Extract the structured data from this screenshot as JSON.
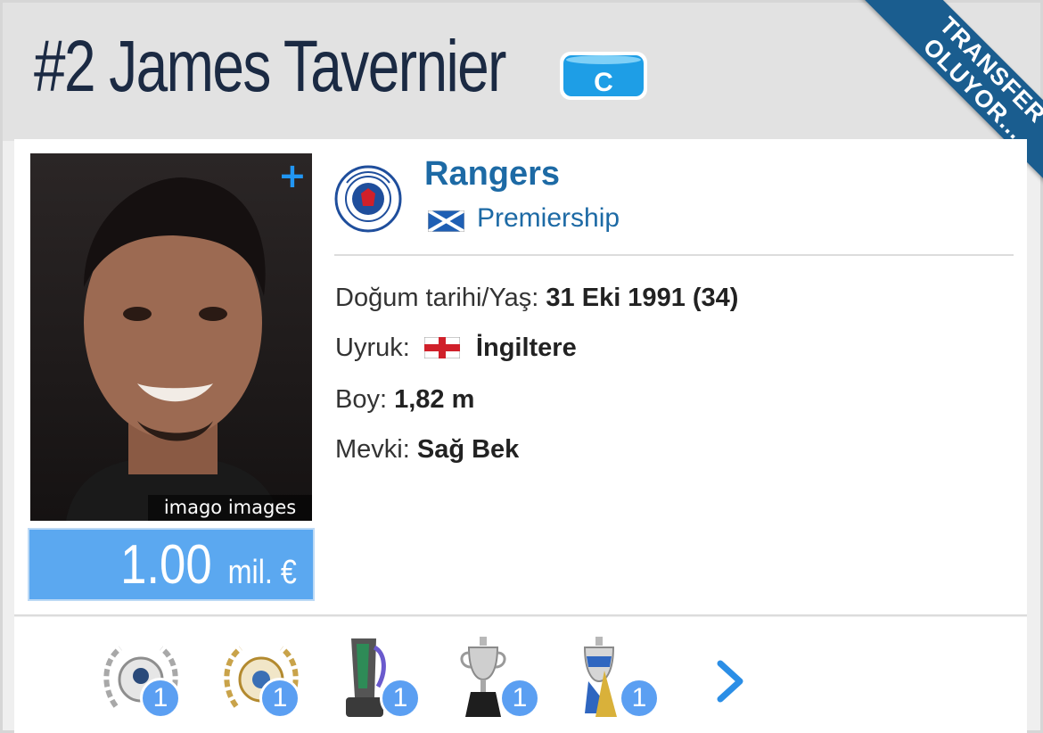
{
  "header": {
    "title": "#2 James Tavernier",
    "captain_badge": "C",
    "ribbon_line1": "TRANSFER",
    "ribbon_line2": "OLUYOR..."
  },
  "player": {
    "photo_credit": "imago images",
    "market_value_number": "1.00",
    "market_value_unit": "mil. €"
  },
  "club": {
    "name": "Rangers",
    "league": "Premiership",
    "league_flag": "scotland-flag"
  },
  "details": {
    "birth_label": "Doğum tarihi/Yaş:",
    "birth_value": "31 Eki 1991 (34)",
    "nationality_label": "Uyruk:",
    "nationality_value": "İngiltere",
    "height_label": "Boy:",
    "height_value": "1,82 m",
    "position_label": "Mevki:",
    "position_value": "Sağ Bek"
  },
  "trophies": [
    {
      "icon": "laurel-medal-icon",
      "count": "1"
    },
    {
      "icon": "gold-laurel-medal-icon",
      "count": "1"
    },
    {
      "icon": "league-trophy-icon",
      "count": "1"
    },
    {
      "icon": "silver-cup-icon",
      "count": "1"
    },
    {
      "icon": "league-cup-icon",
      "count": "1"
    }
  ],
  "colors": {
    "accent": "#1d6aa5",
    "ribbon": "#1a5d8f",
    "value_box": "#5ba8f0",
    "badge": "#5b9ff2"
  }
}
